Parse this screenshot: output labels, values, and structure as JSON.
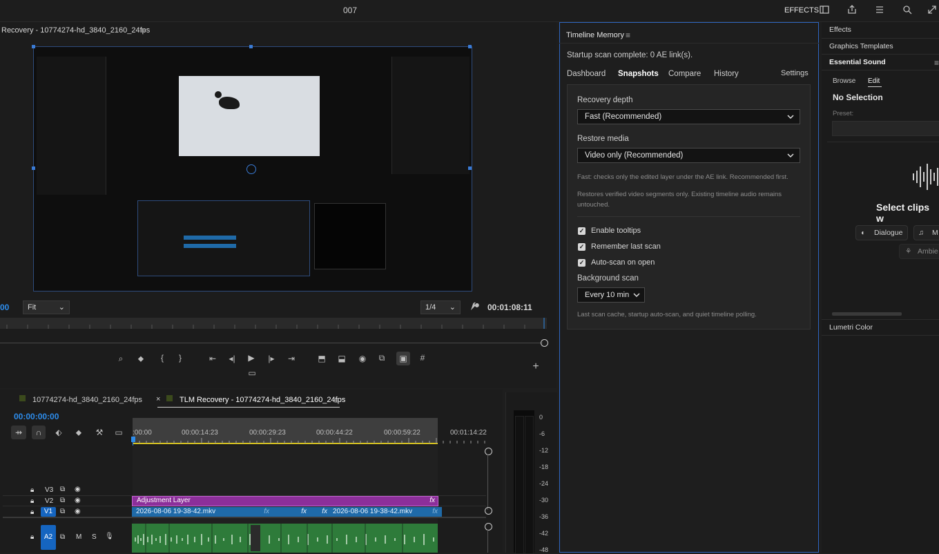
{
  "topbar": {
    "title": "007",
    "effects_label": "EFFECTS",
    "icons": [
      "panel-icon",
      "export-icon",
      "menu-icon",
      "search-icon",
      "expand-icon"
    ]
  },
  "program_monitor": {
    "title": "Recovery - 10774274-hd_3840_2160_24fps",
    "timecode_left": "00",
    "fit_label": "Fit",
    "resolution_label": "1/4",
    "timecode_right": "00:01:08:11",
    "playback_controls": [
      "marker-search-icon",
      "add-marker-icon",
      "mark-in-icon",
      "mark-out-icon",
      "go-to-in-icon",
      "step-back-icon",
      "play-icon",
      "step-forward-icon",
      "go-to-out-icon",
      "lift-icon",
      "extract-icon",
      "camera-icon",
      "multi-camera-icon",
      "overlay-icon",
      "grid-icon",
      "safe-margins-icon",
      "add-button-icon"
    ]
  },
  "timeline": {
    "tabs": [
      {
        "label": "10774274-hd_3840_2160_24fps"
      },
      {
        "label": "TLM Recovery - 10774274-hd_3840_2160_24fps"
      }
    ],
    "current_time": "00:00:00:00",
    "ruler_ticks": [
      ":00:00",
      "00:00:14:23",
      "00:00:29:23",
      "00:00:44:22",
      "00:00:59:22",
      "00:01:14:22"
    ],
    "tracks": {
      "v3": "V3",
      "v2": "V2",
      "v1": "V1",
      "a2": "A2"
    },
    "clips": {
      "adjustment": "Adjustment Layer",
      "video_a": "2026-08-06 19-38-42.mkv",
      "video_b": "2026-08-06 19-38-42.mkv",
      "fx": "fx"
    },
    "audio_meter_ticks": [
      "0",
      "-6",
      "-12",
      "-18",
      "-24",
      "-30",
      "-36",
      "-42",
      "-48"
    ]
  },
  "tlm_panel": {
    "title": "Timeline Memory",
    "status": "Startup scan complete: 0 AE link(s).",
    "tabs": [
      {
        "label": "Dashboard"
      },
      {
        "label": "Snapshots",
        "active": true
      },
      {
        "label": "Compare"
      },
      {
        "label": "History"
      }
    ],
    "settings_label": "Settings",
    "recovery_depth_label": "Recovery depth",
    "recovery_depth_value": "Fast (Recommended)",
    "restore_media_label": "Restore media",
    "restore_media_value": "Video only (Recommended)",
    "help_fast": "Fast: checks only the edited layer under the AE link. Recommended first.",
    "help_restore": "Restores verified video segments only. Existing timeline audio remains untouched.",
    "checkboxes": [
      {
        "label": "Enable tooltips",
        "checked": true
      },
      {
        "label": "Remember last scan",
        "checked": true
      },
      {
        "label": "Auto-scan on open",
        "checked": true
      }
    ],
    "background_scan_label": "Background scan",
    "background_scan_value": "Every 10 min",
    "footer_note": "Last scan cache, startup auto-scan, and quiet timeline polling."
  },
  "right_panel": {
    "effects": "Effects",
    "graphics_templates": "Graphics Templates",
    "essential_sound": "Essential Sound",
    "browse_tab": "Browse",
    "edit_tab": "Edit",
    "no_selection": "No Selection",
    "preset_label": "Preset:",
    "select_clips": "Select clips w",
    "dialogue": "Dialogue",
    "music": "M",
    "ambience": "Ambie",
    "lumetri_color": "Lumetri Color"
  },
  "colors": {
    "accent_blue": "#2d8ceb",
    "adjustment_purple": "#8c2f9a",
    "video_clip_blue": "#1f6aa8",
    "audio_clip_green": "#2e7b3a",
    "panel_border_blue": "#2f66c2"
  }
}
